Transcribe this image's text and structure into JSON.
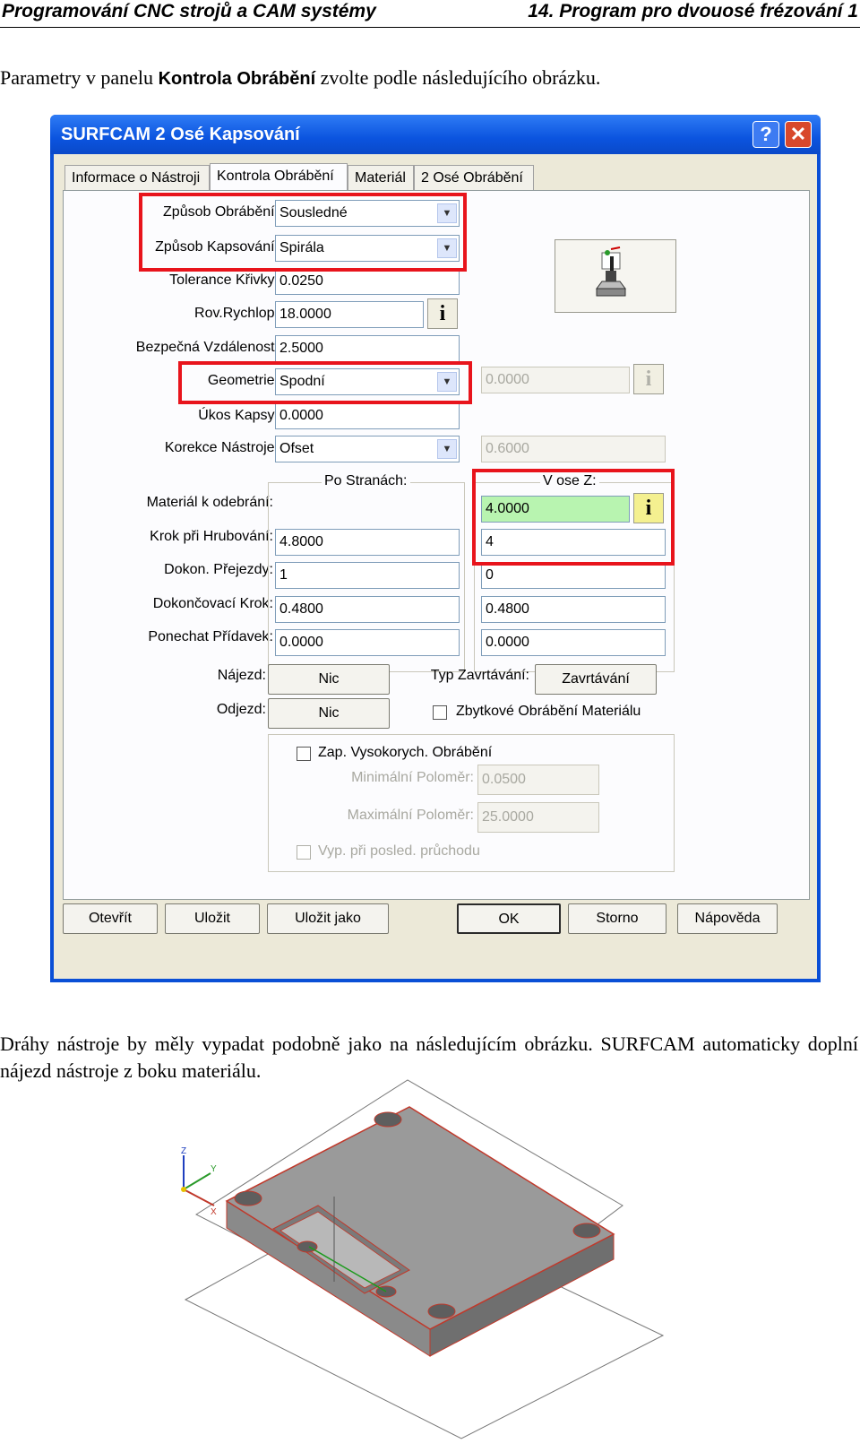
{
  "header": {
    "left": "Programování CNC strojů a CAM systémy",
    "right": "14. Program pro dvouosé frézování 1"
  },
  "intro": {
    "before": "Parametry v panelu ",
    "bold": "Kontrola Obrábění",
    "after": " zvolte podle následujícího obrázku."
  },
  "dialog": {
    "title": "SURFCAM 2 Osé Kapsování",
    "title_buttons": {
      "help": "?",
      "close": "✕"
    },
    "tabs": [
      "Informace o Nástroji",
      "Kontrola Obrábění",
      "Materiál",
      "2 Osé Obrábění"
    ],
    "labels": {
      "zpusob_obrabeni": "Způsob Obrábění:",
      "zpusob_kapsovani": "Způsob Kapsování:",
      "tolerance": "Tolerance Křivky:",
      "rov_rychlop": "Rov.Rychlop:",
      "bezpecna": "Bezpečná Vzdálenost:",
      "geometrie": "Geometrie:",
      "ukos": "Úkos Kapsy:",
      "korekce": "Korekce Nástroje:",
      "material": "Materiál k odebrání:",
      "krok_hrub": "Krok při Hrubování:",
      "dokon_prejezdy": "Dokon. Přejezdy:",
      "dokon_krok": "Dokončovací Krok:",
      "ponechat": "Ponechat Přídavek:",
      "najezd": "Nájezd:",
      "odjezd": "Odjezd:",
      "typ_zavrt": "Typ Zavrtávání:"
    },
    "values": {
      "zpusob_obrabeni": "Sousledné",
      "zpusob_kapsovani": "Spirála",
      "tolerance": "0.0250",
      "rov_rychlop": "18.0000",
      "bezpecna": "2.5000",
      "geometrie": "Spodní",
      "geometrie_side": "0.0000",
      "ukos": "0.0000",
      "korekce": "Ofset",
      "korekce_side": "0.6000"
    },
    "groups": {
      "po_stranach": "Po Stranách:",
      "v_ose_z": "V ose Z:"
    },
    "side_column": {
      "krok_hrub": "4.8000",
      "dokon_prejezdy": "1",
      "dokon_krok": "0.4800",
      "ponechat": "0.0000"
    },
    "z_column": {
      "material": "4.0000",
      "krok_hrub": "4",
      "dokon_prejezdy": "0",
      "dokon_krok": "0.4800",
      "ponechat": "0.0000"
    },
    "info_icon": "i",
    "buttons": {
      "najezd": "Nic",
      "odjezd": "Nic",
      "zavrtavani": "Zavrtávání",
      "otevrit": "Otevřít",
      "ulozit": "Uložit",
      "ulozit_jako": "Uložit jako",
      "ok": "OK",
      "storno": "Storno",
      "napoveda": "Nápověda"
    },
    "checkboxes": {
      "zbytkove": "Zbytkové Obrábění Materiálu",
      "vysokorych": "Zap. Vysokorych. Obrábění",
      "vyp": "Vyp. při posled. průchodu"
    },
    "highspeed": {
      "min_label": "Minimální Poloměr:",
      "min_value": "0.0500",
      "max_label": "Maximální Poloměr:",
      "max_value": "25.0000"
    },
    "highlight_color": "#e8141c"
  },
  "paragraph2": "Dráhy nástroje by měly vypadat podobně jako na následujícím obrázku. SURFCAM automaticky doplní nájezd nástroje z boku materiálu.",
  "figure": {
    "axis_labels": {
      "z": "Z",
      "y": "Y",
      "x": "X"
    }
  }
}
